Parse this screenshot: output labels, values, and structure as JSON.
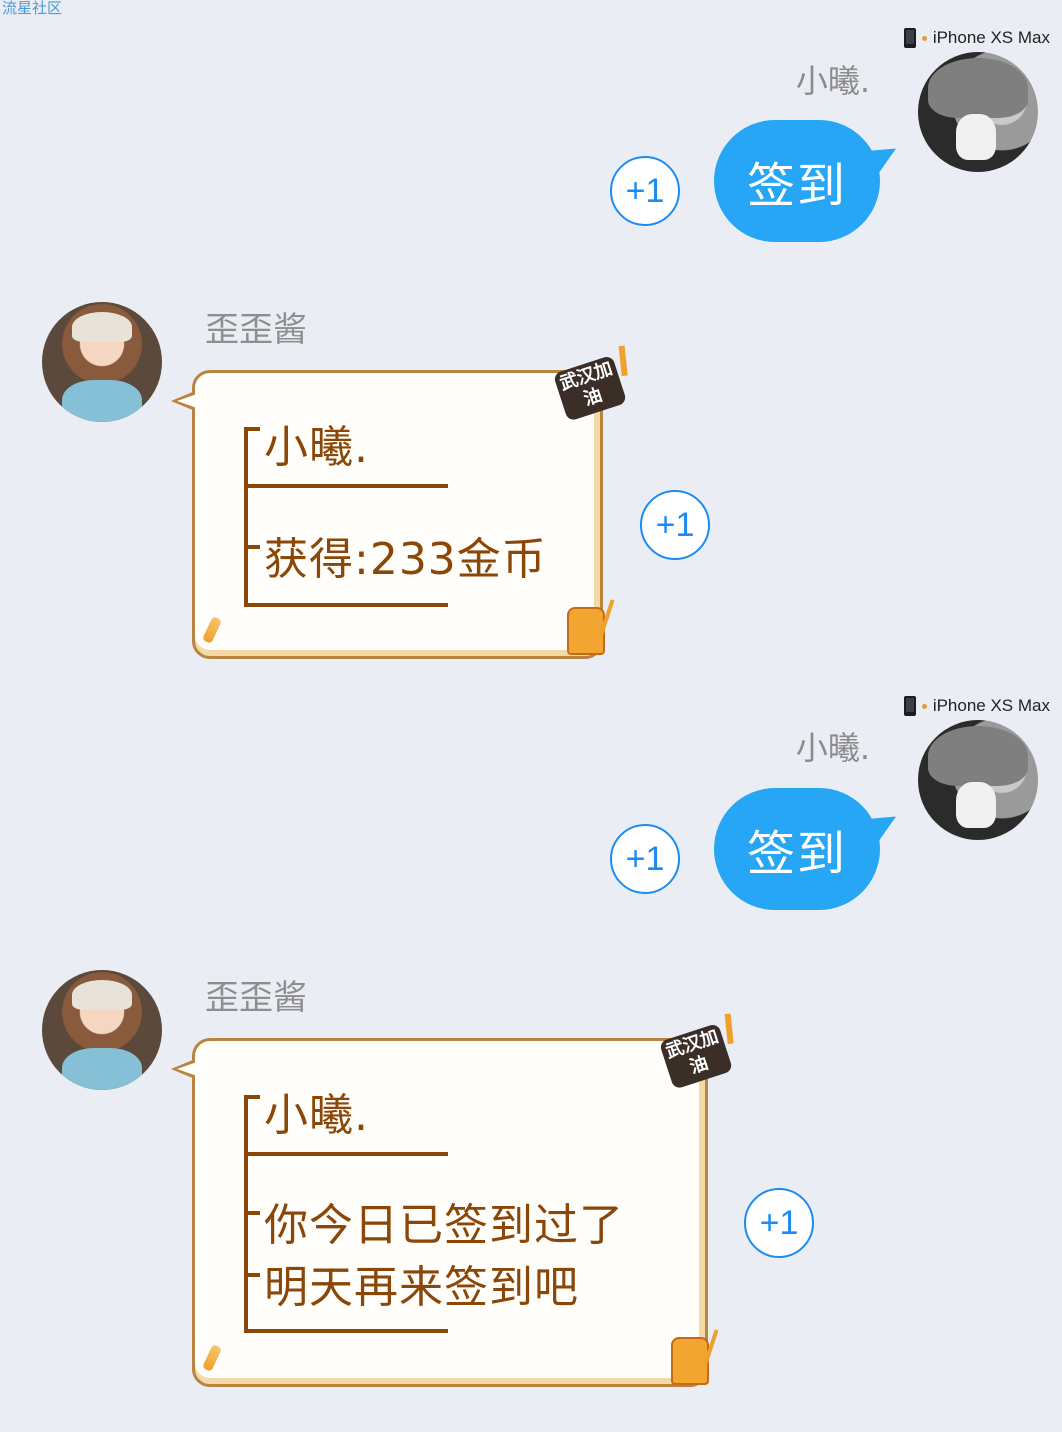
{
  "watermark": "流星社区",
  "messages": [
    {
      "device": "iPhone XS Max",
      "sender": "小曦.",
      "text": "签到",
      "plus": "+1"
    },
    {
      "sender": "歪歪酱",
      "lines": [
        "小曦.",
        "获得:233金币"
      ],
      "badge": "武汉加油",
      "plus": "+1"
    },
    {
      "device": "iPhone XS Max",
      "sender": "小曦.",
      "text": "签到",
      "plus": "+1"
    },
    {
      "sender": "歪歪酱",
      "lines": [
        "小曦.",
        "你今日已签到过了",
        "明天再来签到吧"
      ],
      "badge": "武汉加油",
      "plus": "+1"
    }
  ],
  "colors": {
    "background": "#ebedf5",
    "bubble_blue": "#26a6f5",
    "plus_blue": "#1c8cf0",
    "card_text": "#8a4708"
  },
  "icons": {
    "device": "phone-icon",
    "avatar_self": "user-avatar",
    "avatar_bot": "bot-avatar"
  }
}
